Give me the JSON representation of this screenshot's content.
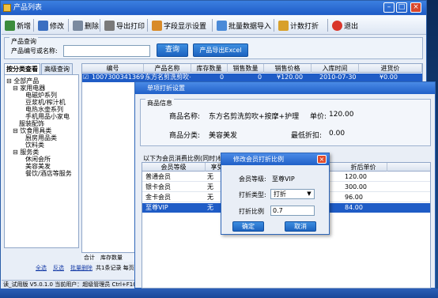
{
  "main_window": {
    "title": "产品列表",
    "toolbar": [
      {
        "label": "新增",
        "icon": "add-icon",
        "color": "#3c8c3c"
      },
      {
        "label": "修改",
        "icon": "edit-icon",
        "color": "#3b6fc1"
      },
      {
        "label": "删除",
        "icon": "delete-icon",
        "color": "#7a8aa0"
      },
      {
        "label": "导出打印",
        "icon": "print-icon",
        "color": "#7a7a7a"
      },
      {
        "label": "字段显示设置",
        "icon": "columns-icon",
        "color": "#d88b2a"
      },
      {
        "label": "批量数据导入",
        "icon": "import-icon",
        "color": "#4a8ad8"
      },
      {
        "label": "计数打折",
        "icon": "discount-icon",
        "color": "#d8a02a"
      },
      {
        "label": "退出",
        "icon": "exit-icon",
        "color": "#d9362b"
      }
    ],
    "search": {
      "group_title": "产品查询",
      "label": "产品编号或名称:",
      "value": "",
      "query_button": "查询",
      "export_button": "产品导出Excel"
    },
    "left_tabs": [
      "按分类查看",
      "高级查询"
    ],
    "tree": [
      {
        "label": "全部产品",
        "level": 0,
        "expander": "−"
      },
      {
        "label": "家用电器",
        "level": 1,
        "expander": "−"
      },
      {
        "label": "电磁炉系列",
        "level": 2
      },
      {
        "label": "豆浆机/榨汁机",
        "level": 2
      },
      {
        "label": "电热水壶系列",
        "level": 2
      },
      {
        "label": "手机用品小家电",
        "level": 2
      },
      {
        "label": "服装配饰",
        "level": 1
      },
      {
        "label": "饮食用具类",
        "level": 1,
        "expander": "−"
      },
      {
        "label": "厨房用品类",
        "level": 2
      },
      {
        "label": "饮料类",
        "level": 2
      },
      {
        "label": "服务类",
        "level": 1,
        "expander": "−"
      },
      {
        "label": "休闲会所",
        "level": 2
      },
      {
        "label": "美容美发",
        "level": 2
      },
      {
        "label": "餐饮/酒店等服务",
        "level": 2
      }
    ],
    "grid": {
      "headers": [
        "编号",
        "产品名称",
        "库存数量",
        "销售数量",
        "销售价格",
        "入库时间",
        "进货价"
      ],
      "rows": [
        {
          "checked": "☑",
          "code": "10073003413699",
          "name": "东方名剪洗剪吹+",
          "stock": "0",
          "sold": "0",
          "price": "¥120.00",
          "date": "2010-07-30",
          "cost": "¥0.00"
        }
      ],
      "footer": {
        "total_label": "合计",
        "stock_label": "库存数量",
        "stock_value": "0"
      }
    },
    "bottom_links": [
      "全选",
      "反选",
      "批量删除",
      "共1条记录 每页"
    ],
    "status_bar": "读_试用版  V5.0.1.0  当前用户：超级管理员  Ctrl+F10找回"
  },
  "discount_window": {
    "title": "单项打折设置",
    "group_title": "商品信息",
    "product_name_label": "商品名称:",
    "product_name_value": "东方名剪洗剪吹+按摩+护理",
    "unit_price_label": "单价:",
    "unit_price_value": "120.00",
    "category_label": "商品分类:",
    "category_value": "美容美发",
    "min_discount_label": "最低折扣:",
    "min_discount_value": "0.00",
    "member_section_title": "以下为会员消费比例(同时)标价的",
    "member_headers": [
      "会员等级",
      "享受",
      "",
      "折后单价"
    ],
    "members": [
      {
        "level": "普通会员",
        "enjoy": "无",
        "price": "120.00"
      },
      {
        "level": "银卡会员",
        "enjoy": "无",
        "price": "300.00"
      },
      {
        "level": "金卡会员",
        "enjoy": "无",
        "price": "96.00"
      },
      {
        "level": "至尊VIP",
        "enjoy": "无",
        "price": "84.00",
        "selected": true
      }
    ]
  },
  "ratio_dialog": {
    "title": "修改会员打折比例",
    "level_label": "会员等级:",
    "level_value": "至尊VIP",
    "type_label": "打折类型:",
    "type_value": "打折",
    "ratio_label": "打折比例",
    "ratio_value": "0.7",
    "ok_button": "确定",
    "cancel_button": "取消"
  },
  "colors": {
    "title_blue": "#1f5cc6",
    "accent_button": "#1c63c0",
    "selected_row": "#1f5cc6",
    "desktop": "#3a6ea5"
  }
}
